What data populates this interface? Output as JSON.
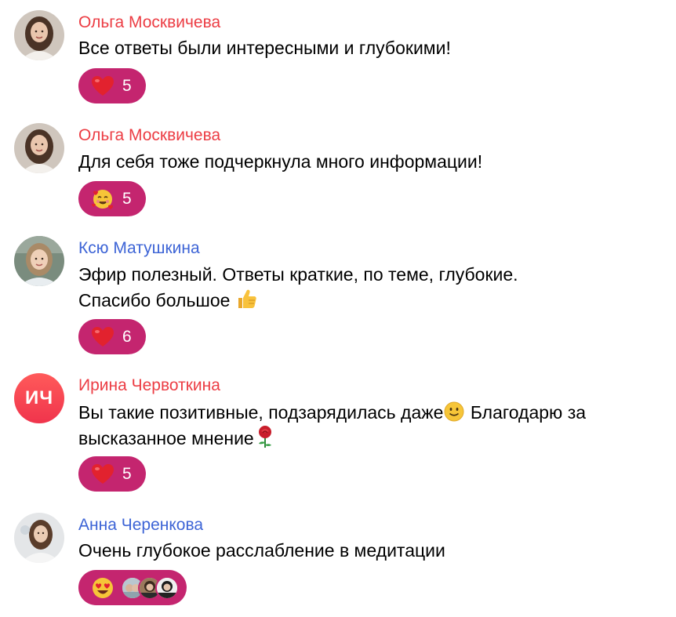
{
  "messages": [
    {
      "author": "Ольга Москвичева",
      "text": "Все ответы были интересными и глубокими!",
      "reaction": "red-heart",
      "count": "5"
    },
    {
      "author": "Ольга Москвичева",
      "text": "Для себя тоже подчеркнула много информации!",
      "reaction": "smiling-face-with-hearts",
      "count": "5"
    },
    {
      "author": "Ксю Матушкина",
      "text_line1": "Эфир полезный. Ответы краткие, по теме, глубокие.",
      "text_line2": "Спасибо большое",
      "text_emoji": "thumbs-up",
      "reaction": "red-heart",
      "count": "6"
    },
    {
      "author": "Ирина Червоткина",
      "initials": "ИЧ",
      "text_part1": "Вы такие позитивные, подзарядилась даже",
      "text_emoji1": "slightly-smiling-face",
      "text_part2": " Благодарю за",
      "text_line2": "высказанное мнение",
      "text_emoji2": "rose",
      "reaction": "red-heart",
      "count": "5"
    },
    {
      "author": "Анна Черенкова",
      "text": "Очень глубокое расслабление в медитации",
      "reaction": "heart-eyes",
      "reactors": 3
    }
  ],
  "colors": {
    "name_red": "#ec3d44",
    "name_blue": "#3d64d6",
    "reaction_bg": "#c4256f"
  }
}
